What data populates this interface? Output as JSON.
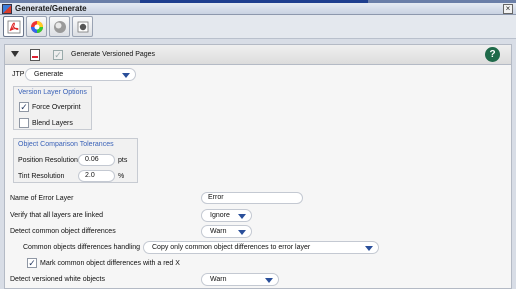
{
  "window": {
    "title": "Generate/Generate",
    "close_glyph": "×"
  },
  "toolbar": {
    "buttons": [
      {
        "icon": "acrobat-pdf-icon"
      },
      {
        "icon": "color-wheel-icon"
      },
      {
        "icon": "sphere-icon"
      },
      {
        "icon": "stamp-icon"
      }
    ]
  },
  "section": {
    "label": "Generate Versioned Pages",
    "check_glyph": "✓",
    "help_glyph": "?"
  },
  "jtp": {
    "label": "JTP",
    "value": "Generate"
  },
  "version_layer_options": {
    "title": "Version Layer Options",
    "force_overprint": {
      "label": "Force Overprint",
      "checked": true,
      "glyph": "✓"
    },
    "blend_layers": {
      "label": "Blend Layers",
      "checked": false
    }
  },
  "object_comparison": {
    "title": "Object Comparison Tolerances",
    "position_resolution": {
      "label": "Position Resolution",
      "value": "0.06",
      "unit": "pts"
    },
    "tint_resolution": {
      "label": "Tint Resolution",
      "value": "2.0",
      "unit": "%"
    }
  },
  "error_layer": {
    "label": "Name of Error Layer",
    "value": "Error"
  },
  "verify_layers": {
    "label": "Verify that all layers are linked",
    "value": "Ignore"
  },
  "detect_common": {
    "label": "Detect common object differences",
    "value": "Warn"
  },
  "common_handling": {
    "label": "Common objects differences handling",
    "value": "Copy only common object differences to error layer"
  },
  "mark_red_x": {
    "label": "Mark common object differences with a red X",
    "checked": true,
    "glyph": "✓"
  },
  "detect_white": {
    "label": "Detect versioned white objects",
    "value": "Warn"
  },
  "colors": {
    "accent": "#3a62b8",
    "help": "#1f6a4a",
    "arrow": "#2a4f9a"
  }
}
